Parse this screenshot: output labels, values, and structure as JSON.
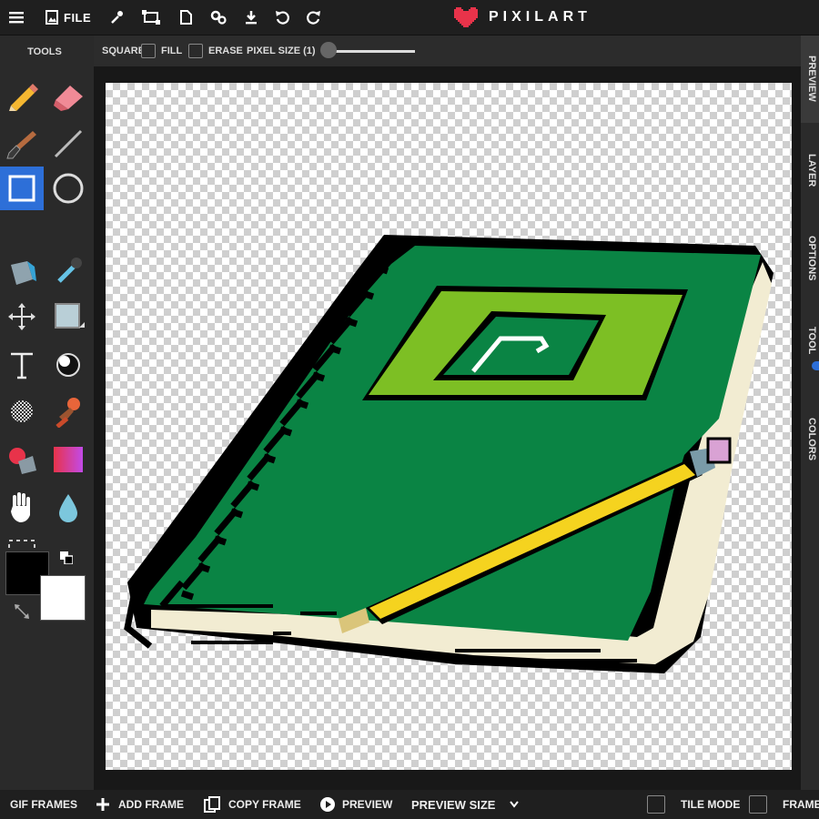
{
  "app": {
    "logo_text": "PIXILART",
    "logo_color": "#e8334a"
  },
  "toolbar": {
    "file_label": "FILE"
  },
  "tools": {
    "title": "TOOLS",
    "items": [
      "pencil",
      "eraser",
      "brush",
      "line",
      "rectangle",
      "ellipse",
      "paint-bucket",
      "eyedropper",
      "move",
      "select-fill",
      "text",
      "lighten",
      "dither",
      "stamp",
      "color-replace",
      "gradient",
      "hand",
      "blur",
      "selection"
    ],
    "active": "rectangle",
    "primary_color": "#000000",
    "secondary_color": "#ffffff",
    "active_color": "#2d6fd8"
  },
  "options": {
    "square_label": "SQUARE:",
    "fill_label": "FILL",
    "erase_label": "ERASE",
    "pixel_size_label": "PIXEL SIZE (1)",
    "pixel_size": 1
  },
  "right_tabs": [
    "PREVIEW",
    "LAYER",
    "OPTIONS",
    "TOOL",
    "COLORS"
  ],
  "bottom": {
    "gif_frames": "GIF FRAMES",
    "add_frame": "ADD FRAME",
    "copy_frame": "COPY FRAME",
    "preview": "PREVIEW",
    "preview_size": "PREVIEW SIZE",
    "tile_mode": "TILE MODE",
    "frames": "FRAMES"
  },
  "artwork": {
    "outline": "#000000",
    "cover": "#0a8444",
    "label": "#7dbf24",
    "pages": "#f2ecd2",
    "pencil_body": "#f5d31f",
    "pencil_tip": "#dac57a",
    "pencil_ferrule": "#7a9ba8",
    "pencil_eraser": "#d9a2d4"
  }
}
